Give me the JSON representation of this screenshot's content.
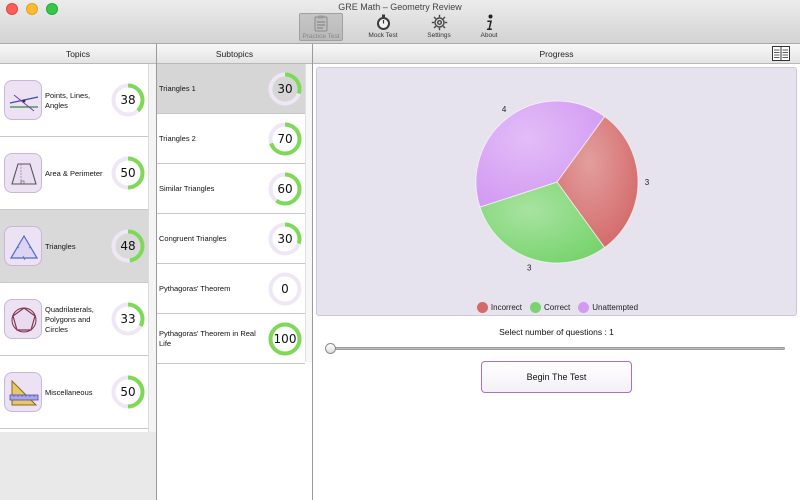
{
  "window": {
    "title": "GRE Math – Geometry Review"
  },
  "toolbar": [
    {
      "id": "practice",
      "label": "Practice Test",
      "icon": "clipboard-icon",
      "active": true
    },
    {
      "id": "mock",
      "label": "Mock Test",
      "icon": "stopwatch-icon",
      "active": false
    },
    {
      "id": "settings",
      "label": "Settings",
      "icon": "gear-icon",
      "active": false
    },
    {
      "id": "about",
      "label": "About",
      "icon": "info-icon",
      "active": false
    }
  ],
  "headers": {
    "topics": "Topics",
    "subtopics": "Subtopics",
    "progress": "Progress"
  },
  "topics": [
    {
      "label": "Points, Lines, Angles",
      "value": 38,
      "icon": "lines-angles-icon",
      "selected": false
    },
    {
      "label": "Area & Perimeter",
      "value": 50,
      "icon": "trapezoid-icon",
      "selected": false
    },
    {
      "label": "Triangles",
      "value": 48,
      "icon": "triangle-icon",
      "selected": true
    },
    {
      "label": "Quadrilaterals, Polygons and Circles",
      "value": 33,
      "icon": "polygon-circle-icon",
      "selected": false
    },
    {
      "label": "Miscellaneous",
      "value": 50,
      "icon": "ruler-icon",
      "selected": false
    }
  ],
  "subtopics": [
    {
      "label": "Triangles 1",
      "value": 30,
      "selected": true
    },
    {
      "label": "Triangles 2",
      "value": 70,
      "selected": false
    },
    {
      "label": "Similar Triangles",
      "value": 60,
      "selected": false
    },
    {
      "label": "Congruent Triangles",
      "value": 30,
      "selected": false
    },
    {
      "label": "Pythagoras' Theorem",
      "value": 0,
      "selected": false
    },
    {
      "label": "Pythagoras' Theorem in Real Life",
      "value": 100,
      "selected": false
    }
  ],
  "colors": {
    "ring_progress": "#7ed957",
    "ring_track": "#efe6f6",
    "incorrect": "#d46a6a",
    "correct": "#79d46f",
    "unattempted": "#d39af3",
    "button_border": "#a870c8"
  },
  "chart_data": {
    "type": "pie",
    "slices": [
      {
        "name": "Incorrect",
        "value": 3
      },
      {
        "name": "Correct",
        "value": 3
      },
      {
        "name": "Unattempted",
        "value": 4
      }
    ],
    "legend": [
      "Incorrect",
      "Correct",
      "Unattempted"
    ],
    "legend_position": "bottom"
  },
  "progress": {
    "select_label": "Select number of questions : 1",
    "slider_value": 1,
    "begin_label": "Begin The Test"
  }
}
